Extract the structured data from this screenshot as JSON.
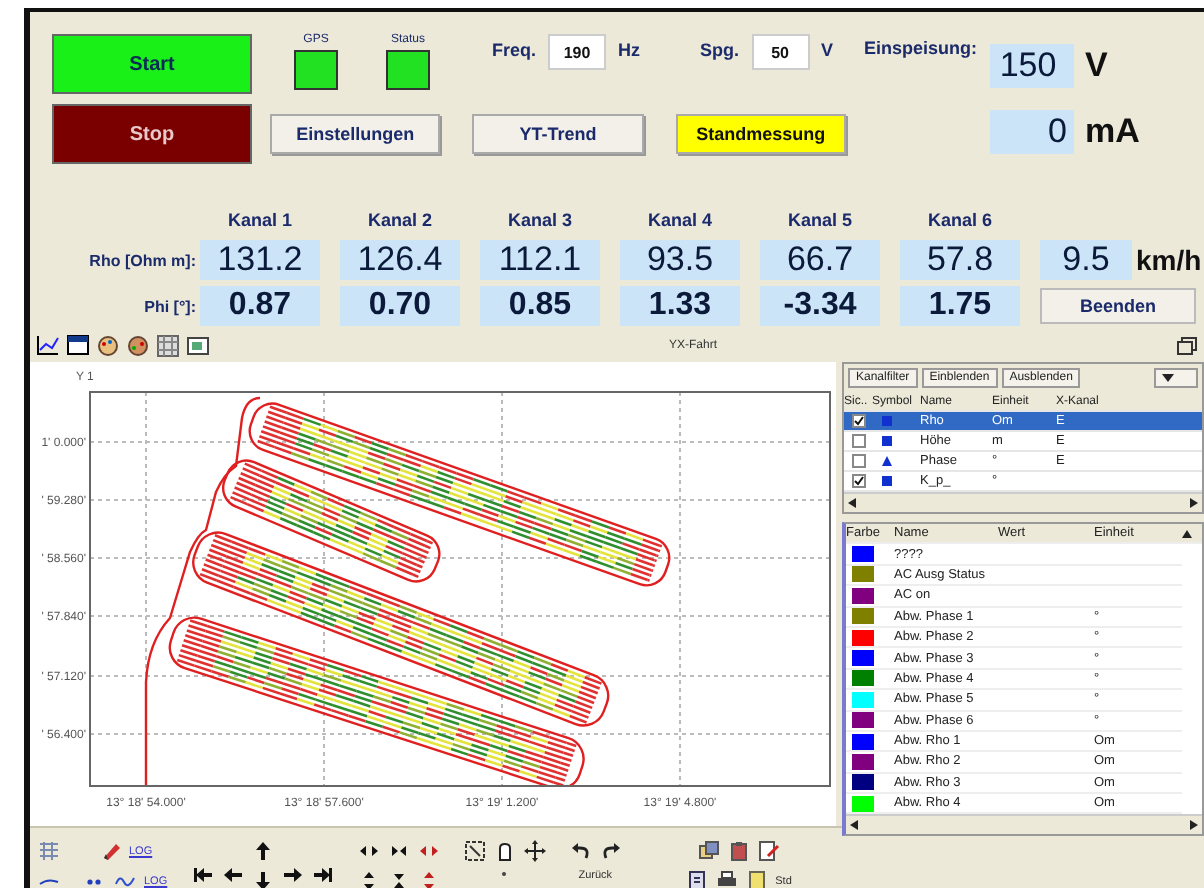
{
  "controls": {
    "start": "Start",
    "stop": "Stop",
    "indicators": [
      {
        "label": "GPS",
        "on": true
      },
      {
        "label": "Status",
        "on": true
      }
    ],
    "fields": [
      {
        "label": "Freq.",
        "value": "190",
        "unit": "Hz"
      },
      {
        "label": "Spg.",
        "value": "50",
        "unit": "V"
      }
    ],
    "feed": {
      "label": "Einspeisung:",
      "voltage": "150",
      "voltage_unit": "V",
      "current": "0",
      "current_unit": "mA"
    },
    "buttons": [
      {
        "label": "Einstellungen",
        "highlighted": false
      },
      {
        "label": "YT-Trend",
        "highlighted": false
      },
      {
        "label": "Standmessung",
        "highlighted": true
      }
    ]
  },
  "readings": {
    "channels": [
      "Kanal 1",
      "Kanal 2",
      "Kanal 3",
      "Kanal 4",
      "Kanal 5",
      "Kanal 6"
    ],
    "rows": [
      {
        "label": "Rho [Ohm m]:",
        "values": [
          "131.2",
          "126.4",
          "112.1",
          "93.5",
          "66.7",
          "57.8"
        ]
      },
      {
        "label": "Phi [°]:",
        "values": [
          "0.87",
          "0.70",
          "0.85",
          "1.33",
          "-3.34",
          "1.75"
        ]
      }
    ],
    "speed": "9.5",
    "speed_unit": "km/h",
    "quit": "Beenden"
  },
  "plot": {
    "title": "YX-Fahrt",
    "y_axis": "Y 1",
    "y_ticks": [
      "1' 0.000'",
      "' 59.280'",
      "' 58.560'",
      "' 57.840'",
      "' 57.120'",
      "' 56.400'"
    ],
    "x_ticks": [
      "13° 18' 54.000'",
      "13° 18' 57.600'",
      "13° 19' 1.200'",
      "13° 19' 4.800'"
    ]
  },
  "channel_table": {
    "buttons": [
      "Kanalfilter",
      "Einblenden",
      "Ausblenden"
    ],
    "columns": [
      "Sic..",
      "Symbol",
      "Name",
      "Einheit",
      "X-Kanal"
    ],
    "rows": [
      {
        "checked": true,
        "selected": true,
        "kind": "square",
        "name": "Rho",
        "unit": "Om",
        "x_channel": "E"
      },
      {
        "checked": false,
        "selected": false,
        "kind": "square",
        "name": "Höhe",
        "unit": "m",
        "x_channel": "E"
      },
      {
        "checked": false,
        "selected": false,
        "kind": "triangle",
        "name": "Phase",
        "unit": "°",
        "x_channel": "E"
      },
      {
        "checked": true,
        "selected": false,
        "kind": "square",
        "name": "K_p_",
        "unit": "°"
      }
    ]
  },
  "legend": {
    "columns": [
      "Farbe",
      "Name",
      "Wert",
      "Einheit"
    ],
    "rows": [
      {
        "color": "#0000ff",
        "name": "????"
      },
      {
        "color": "#808000",
        "name": "AC Ausg Status"
      },
      {
        "color": "#800080",
        "name": "AC on"
      },
      {
        "color": "#808000",
        "name": "Abw. Phase 1",
        "unit": "°"
      },
      {
        "color": "#ff0000",
        "name": "Abw. Phase 2",
        "unit": "°"
      },
      {
        "color": "#0000ff",
        "name": "Abw. Phase 3",
        "unit": "°"
      },
      {
        "color": "#008000",
        "name": "Abw. Phase 4",
        "unit": "°"
      },
      {
        "color": "#00ffff",
        "name": "Abw. Phase 5",
        "unit": "°"
      },
      {
        "color": "#800080",
        "name": "Abw. Phase 6",
        "unit": "°"
      },
      {
        "color": "#0000ff",
        "name": "Abw. Rho 1",
        "unit": "Om"
      },
      {
        "color": "#800080",
        "name": "Abw. Rho 2",
        "unit": "Om"
      },
      {
        "color": "#000080",
        "name": "Abw. Rho 3",
        "unit": "Om"
      },
      {
        "color": "#00ff00",
        "name": "Abw. Rho 4",
        "unit": "Om"
      }
    ]
  },
  "toolbar": {
    "log_labels": [
      "LOG",
      "LOG"
    ],
    "undo_label": "Zurück",
    "std_label": "Std"
  }
}
